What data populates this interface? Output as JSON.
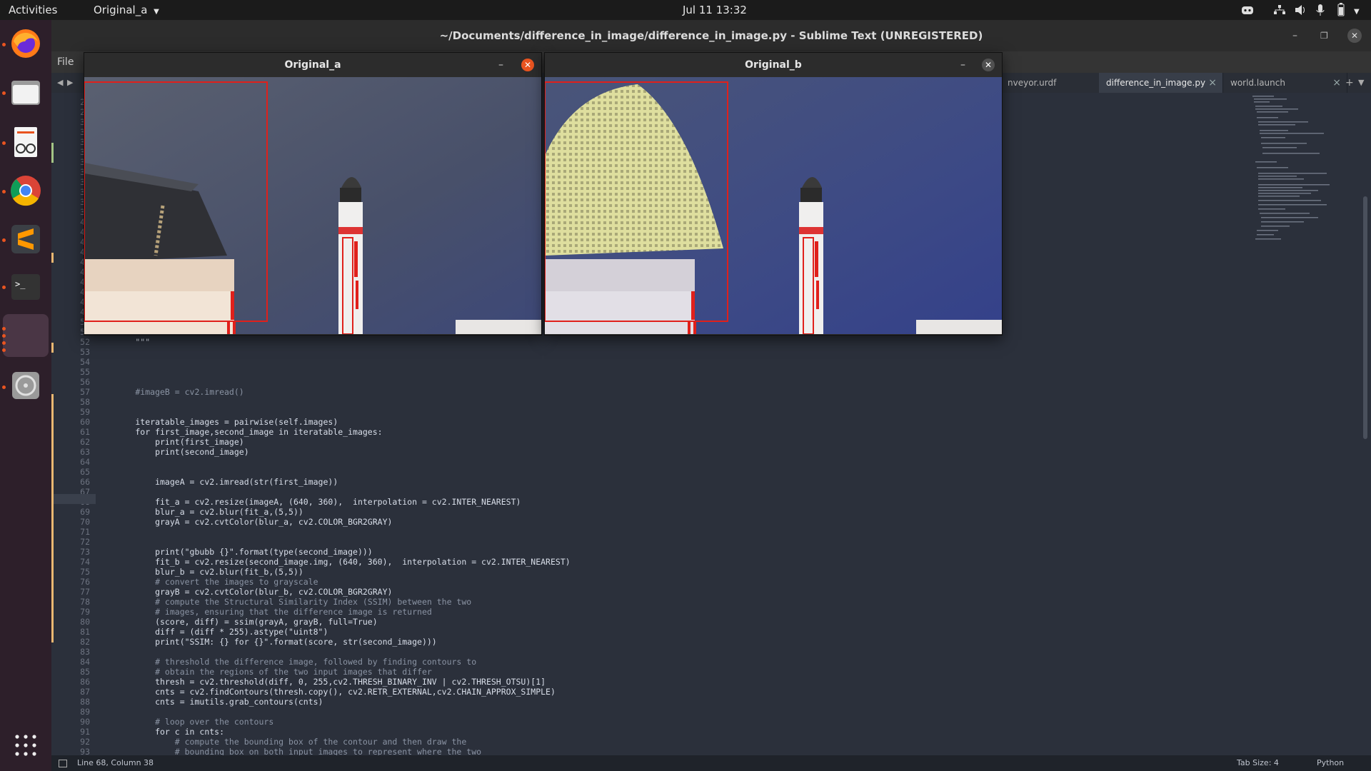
{
  "topbar": {
    "activities": "Activities",
    "app_menu": "Original_a",
    "clock": "Jul 11  13:32"
  },
  "dock": {
    "items": [
      {
        "name": "firefox"
      },
      {
        "name": "files"
      },
      {
        "name": "document-viewer"
      },
      {
        "name": "chrome"
      },
      {
        "name": "sublime-text"
      },
      {
        "name": "terminal"
      },
      {
        "name": "active-window"
      },
      {
        "name": "disc"
      }
    ]
  },
  "sublime": {
    "title": "~/Documents/difference_in_image/difference_in_image.py - Sublime Text (UNREGISTERED)",
    "menu_file": "File",
    "tabs": [
      {
        "label": "nveyor.urdf",
        "active": false
      },
      {
        "label": "difference_in_image.py",
        "active": true
      },
      {
        "label": "world.launch",
        "active": false
      }
    ],
    "status_left": "Line 68, Column 38",
    "status_tab": "Tab Size: 4",
    "status_syntax": "Python"
  },
  "code": {
    "lines": [
      {
        "n": "28",
        "t": ""
      },
      {
        "n": "29",
        "t": ""
      },
      {
        "n": "30",
        "t": ""
      },
      {
        "n": "31",
        "t": ""
      },
      {
        "n": "32",
        "t": ""
      },
      {
        "n": "33",
        "t": ""
      },
      {
        "n": "34",
        "t": ""
      },
      {
        "n": "35",
        "t": ""
      },
      {
        "n": "36",
        "t": ""
      },
      {
        "n": "37",
        "t": ""
      },
      {
        "n": "38",
        "t": ""
      },
      {
        "n": "39",
        "t": ""
      },
      {
        "n": "40",
        "t": ""
      },
      {
        "n": "41",
        "t": ""
      },
      {
        "n": "42",
        "t": ""
      },
      {
        "n": "43",
        "t": ""
      },
      {
        "n": "44",
        "t": ""
      },
      {
        "n": "45",
        "t": ""
      },
      {
        "n": "46",
        "t": ""
      },
      {
        "n": "47",
        "t": ""
      },
      {
        "n": "48",
        "t": ""
      },
      {
        "n": "49",
        "t": ""
      },
      {
        "n": "50",
        "t": ""
      },
      {
        "n": "51",
        "t": ""
      },
      {
        "n": "52",
        "t": "        \"\"\""
      },
      {
        "n": "53",
        "t": ""
      },
      {
        "n": "54",
        "t": ""
      },
      {
        "n": "55",
        "t": ""
      },
      {
        "n": "56",
        "t": ""
      },
      {
        "n": "57",
        "t": "        #imageB = cv2.imread()"
      },
      {
        "n": "58",
        "t": ""
      },
      {
        "n": "59",
        "t": ""
      },
      {
        "n": "60",
        "t": "        iteratable_images = pairwise(self.images)"
      },
      {
        "n": "61",
        "t": "        for first_image,second_image in iteratable_images:"
      },
      {
        "n": "62",
        "t": "            print(first_image)"
      },
      {
        "n": "63",
        "t": "            print(second_image)"
      },
      {
        "n": "64",
        "t": ""
      },
      {
        "n": "65",
        "t": ""
      },
      {
        "n": "66",
        "t": "            imageA = cv2.imread(str(first_image))"
      },
      {
        "n": "67",
        "t": ""
      },
      {
        "n": "68",
        "t": "            fit_a = cv2.resize(imageA, (640, 360),  interpolation = cv2.INTER_NEAREST)"
      },
      {
        "n": "69",
        "t": "            blur_a = cv2.blur(fit_a,(5,5))"
      },
      {
        "n": "70",
        "t": "            grayA = cv2.cvtColor(blur_a, cv2.COLOR_BGR2GRAY)"
      },
      {
        "n": "71",
        "t": ""
      },
      {
        "n": "72",
        "t": ""
      },
      {
        "n": "73",
        "t": "            print(\"gbubb {}\".format(type(second_image)))"
      },
      {
        "n": "74",
        "t": "            fit_b = cv2.resize(second_image.img, (640, 360),  interpolation = cv2.INTER_NEAREST)"
      },
      {
        "n": "75",
        "t": "            blur_b = cv2.blur(fit_b,(5,5))"
      },
      {
        "n": "76",
        "t": "            # convert the images to grayscale"
      },
      {
        "n": "77",
        "t": "            grayB = cv2.cvtColor(blur_b, cv2.COLOR_BGR2GRAY)"
      },
      {
        "n": "78",
        "t": "            # compute the Structural Similarity Index (SSIM) between the two"
      },
      {
        "n": "79",
        "t": "            # images, ensuring that the difference image is returned"
      },
      {
        "n": "80",
        "t": "            (score, diff) = ssim(grayA, grayB, full=True)"
      },
      {
        "n": "81",
        "t": "            diff = (diff * 255).astype(\"uint8\")"
      },
      {
        "n": "82",
        "t": "            print(\"SSIM: {} for {}\".format(score, str(second_image)))"
      },
      {
        "n": "83",
        "t": ""
      },
      {
        "n": "84",
        "t": "            # threshold the difference image, followed by finding contours to"
      },
      {
        "n": "85",
        "t": "            # obtain the regions of the two input images that differ"
      },
      {
        "n": "86",
        "t": "            thresh = cv2.threshold(diff, 0, 255,cv2.THRESH_BINARY_INV | cv2.THRESH_OTSU)[1]"
      },
      {
        "n": "87",
        "t": "            cnts = cv2.findContours(thresh.copy(), cv2.RETR_EXTERNAL,cv2.CHAIN_APPROX_SIMPLE)"
      },
      {
        "n": "88",
        "t": "            cnts = imutils.grab_contours(cnts)"
      },
      {
        "n": "89",
        "t": ""
      },
      {
        "n": "90",
        "t": "            # loop over the contours"
      },
      {
        "n": "91",
        "t": "            for c in cnts:"
      },
      {
        "n": "92",
        "t": "                # compute the bounding box of the contour and then draw the"
      },
      {
        "n": "93",
        "t": "                # bounding box on both input images to represent where the two"
      }
    ]
  },
  "windows": {
    "a": {
      "title": "Original_a",
      "min": "–"
    },
    "b": {
      "title": "Original_b",
      "min": "–"
    }
  },
  "colors": {
    "accent": "#e95420",
    "box": "#e0201b"
  }
}
